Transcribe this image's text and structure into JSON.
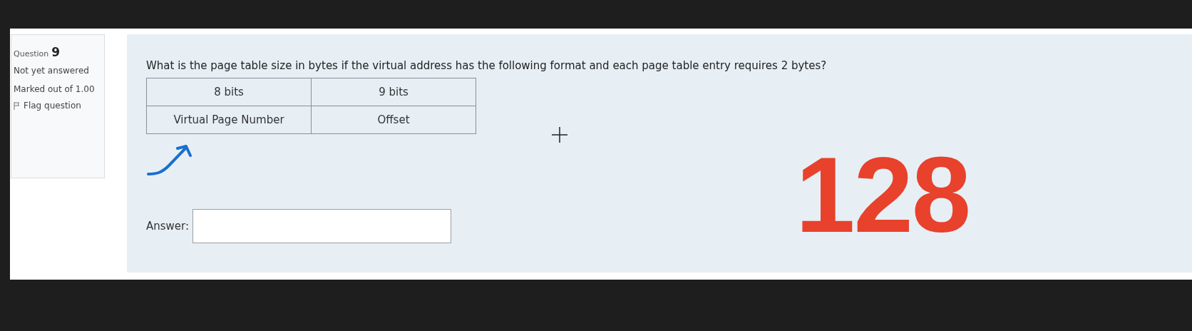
{
  "info": {
    "question_label": "Question",
    "question_number": "9",
    "status": "Not yet answered",
    "marks": "Marked out of 1.00",
    "flag": "Flag question"
  },
  "question": {
    "text": "What is the page table size in bytes if the virtual address has the following format and each page table entry requires 2 bytes?",
    "table": {
      "rows": [
        [
          "8 bits",
          "9 bits"
        ],
        [
          "Virtual Page Number",
          "Offset"
        ]
      ]
    },
    "answer_label": "Answer:"
  },
  "annotation": {
    "text": "128",
    "color": "#e8412c"
  }
}
